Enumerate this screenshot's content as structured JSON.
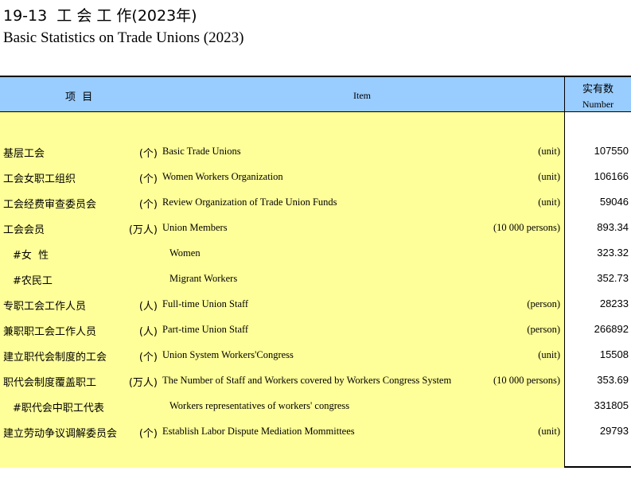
{
  "title": {
    "cn": "19-13  工 会 工 作(2023年)",
    "en": "Basic Statistics on Trade Unions (2023)"
  },
  "header": {
    "item_cn": "项  目",
    "item_en": "Item",
    "number_cn": "实有数",
    "number_en": "Number"
  },
  "rows": [
    {
      "cn": "基层工会",
      "unit_cn": "(个)",
      "en": "Basic Trade Unions",
      "unit_en": "(unit)",
      "value": "107550"
    },
    {
      "cn": "工会女职工组织",
      "unit_cn": "(个)",
      "en": "Women Workers Organization",
      "unit_en": "(unit)",
      "value": "106166"
    },
    {
      "cn": "工会经费审查委员会",
      "unit_cn": "(个)",
      "en": "Review Organization of Trade Union Funds",
      "unit_en": "(unit)",
      "value": "59046"
    },
    {
      "cn": "工会会员",
      "unit_cn": "(万人)",
      "en": "Union Members",
      "unit_en": "(10 000 persons)",
      "value": "893.34"
    },
    {
      "cn": "#女  性",
      "unit_cn": "",
      "en": "Women",
      "unit_en": "",
      "value": "323.32"
    },
    {
      "cn": "#农民工",
      "unit_cn": "",
      "en": "Migrant Workers",
      "unit_en": "",
      "value": "352.73"
    },
    {
      "cn": "专职工会工作人员",
      "unit_cn": "(人)",
      "en": "Full-time Union Staff",
      "unit_en": "(person)",
      "value": "28233"
    },
    {
      "cn": "兼职职工会工作人员",
      "unit_cn": "(人)",
      "en": "Part-time Union Staff",
      "unit_en": "(person)",
      "value": "266892"
    },
    {
      "cn": "建立职代会制度的工会",
      "unit_cn": "(个)",
      "en": "Union System Workers'Congress",
      "unit_en": "(unit)",
      "value": "15508"
    },
    {
      "cn": "职代会制度覆盖职工",
      "unit_cn": "(万人)",
      "en": "The Number of Staff and Workers covered by Workers Congress System",
      "unit_en": "(10 000 persons)",
      "value": "353.69"
    },
    {
      "cn": "#职代会中职工代表",
      "unit_cn": "",
      "en": "Workers representatives of workers' congress",
      "unit_en": "",
      "value": "331805"
    },
    {
      "cn": "建立劳动争议调解委员会",
      "unit_cn": "(个)",
      "en": "Establish Labor Dispute Mediation Mommittees",
      "unit_en": "(unit)",
      "value": "29793"
    }
  ]
}
